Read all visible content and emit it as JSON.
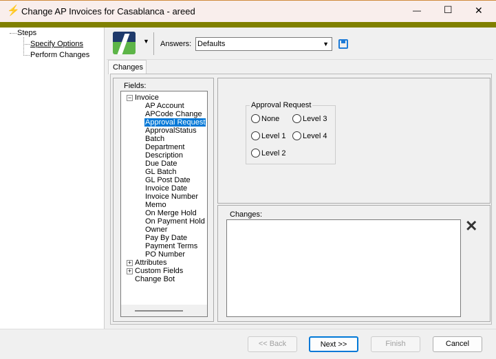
{
  "window": {
    "title": "Change AP Invoices for Casablanca - areed",
    "minimize": "—",
    "maximize": "☐",
    "close": "✕"
  },
  "steps": {
    "root": "Steps",
    "items": [
      "Specify Options",
      "Perform Changes"
    ]
  },
  "toolbar": {
    "answers_label": "Answers:",
    "answers_value": "Defaults"
  },
  "tabs": [
    "Changes"
  ],
  "fields": {
    "label": "Fields:",
    "tree": {
      "invoice": "Invoice",
      "invoice_items": [
        "AP Account",
        "APCode Change",
        "Approval Request",
        "ApprovalStatus",
        "Batch",
        "Department",
        "Description",
        "Due Date",
        "GL Batch",
        "GL Post Date",
        "Invoice Date",
        "Invoice Number",
        "Memo",
        "On Merge Hold",
        "On Payment Hold",
        "Owner",
        "Pay By Date",
        "Payment Terms",
        "PO Number"
      ],
      "attributes": "Attributes",
      "custom_fields": "Custom Fields",
      "change_bot": "Change Bot"
    },
    "selected": "Approval Request"
  },
  "approval": {
    "title": "Approval Request",
    "options": [
      "None",
      "Level 1",
      "Level 2",
      "Level 3",
      "Level 4"
    ]
  },
  "changes": {
    "label": "Changes:"
  },
  "buttons": {
    "back": "<< Back",
    "next": "Next >>",
    "finish": "Finish",
    "cancel": "Cancel"
  }
}
